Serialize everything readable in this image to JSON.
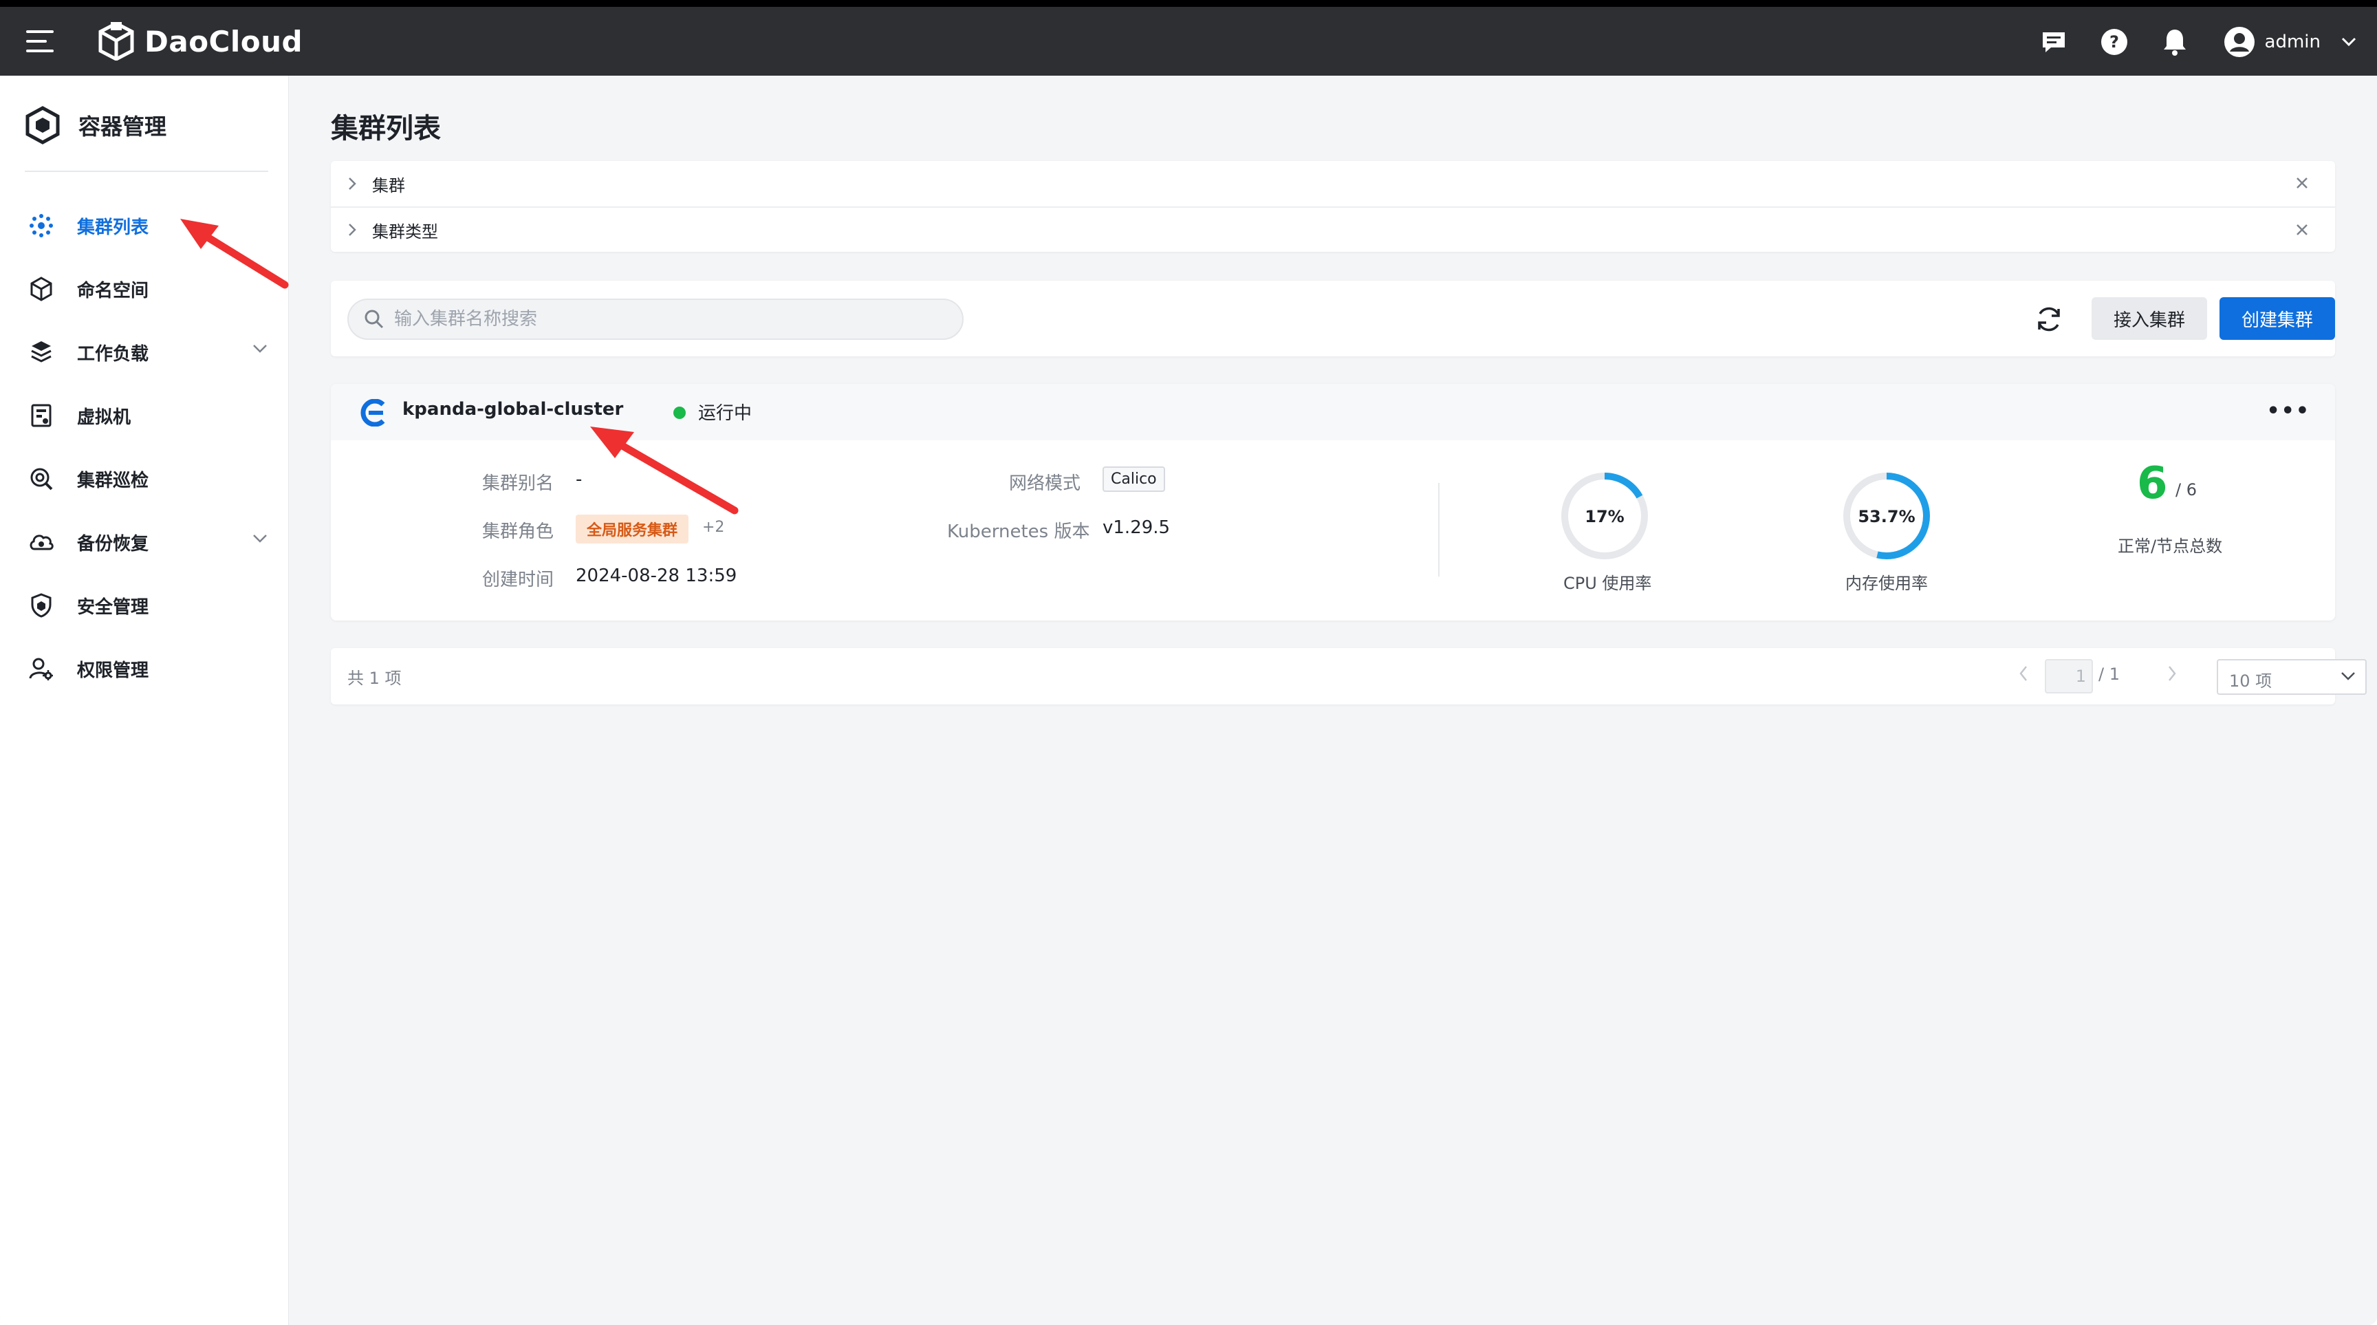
{
  "topbar": {
    "brand": "DaoCloud",
    "user_name": "admin",
    "icons": [
      "menu-icon",
      "message-icon",
      "help-icon",
      "bell-icon",
      "user-avatar-icon",
      "chevron-down-icon"
    ]
  },
  "sidebar": {
    "title": "容器管理",
    "items": [
      {
        "label": "集群列表",
        "icon": "cluster-icon",
        "active": true
      },
      {
        "label": "命名空间",
        "icon": "cube-icon"
      },
      {
        "label": "工作负载",
        "icon": "workload-icon",
        "expandable": true
      },
      {
        "label": "虚拟机",
        "icon": "vm-icon"
      },
      {
        "label": "集群巡检",
        "icon": "inspect-icon"
      },
      {
        "label": "备份恢复",
        "icon": "backup-icon",
        "expandable": true
      },
      {
        "label": "安全管理",
        "icon": "shield-icon"
      },
      {
        "label": "权限管理",
        "icon": "permission-icon"
      }
    ]
  },
  "main": {
    "page_title": "集群列表",
    "filters": [
      {
        "label": "集群"
      },
      {
        "label": "集群类型"
      }
    ],
    "search": {
      "placeholder": "输入集群名称搜索",
      "value": ""
    },
    "buttons": {
      "connect": "接入集群",
      "create": "创建集群"
    },
    "cluster": {
      "name": "kpanda-global-cluster",
      "status": "运行中",
      "alias_label": "集群别名",
      "alias_value": "-",
      "role_label": "集群角色",
      "role_value": "全局服务集群",
      "role_more": "+2",
      "created_label": "创建时间",
      "created_value": "2024-08-28 13:59",
      "network_label": "网络模式",
      "network_value": "Calico",
      "k8s_label": "Kubernetes 版本",
      "k8s_value": "v1.29.5",
      "cpu": {
        "value": "17%",
        "fraction": 0.17,
        "label": "CPU 使用率"
      },
      "memory": {
        "value": "53.7%",
        "fraction": 0.537,
        "label": "内存使用率"
      },
      "nodes": {
        "normal": "6",
        "total": "/ 6",
        "label": "正常/节点总数"
      }
    },
    "pagination": {
      "total": "共 1 项",
      "page": "1",
      "pages": "/ 1",
      "page_size": "10 项"
    }
  },
  "colors": {
    "accent": "#0f6fde",
    "topbar": "#2d2f33",
    "running": "#19b94a",
    "gauge": "#1f9ee8",
    "annotation_arrow": "#ee3030"
  }
}
